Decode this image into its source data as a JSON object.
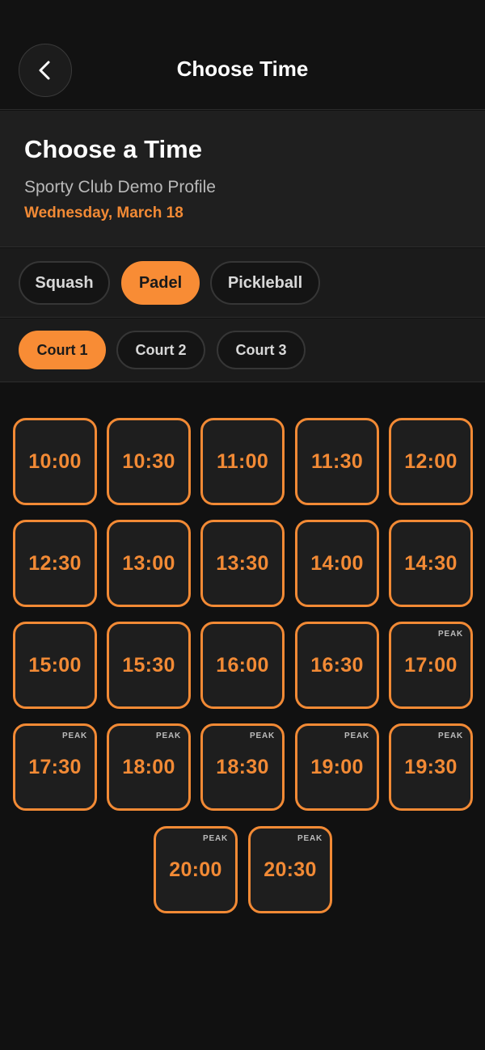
{
  "header": {
    "back_icon": "chevron-left-icon",
    "title": "Choose Time"
  },
  "info": {
    "heading": "Choose a Time",
    "club": "Sporty Club Demo Profile",
    "date": "Wednesday, March 18"
  },
  "colors": {
    "accent": "#f88c35",
    "background": "#111111",
    "panel": "#1f1f1f"
  },
  "sports": [
    {
      "label": "Squash",
      "active": false
    },
    {
      "label": "Padel",
      "active": true
    },
    {
      "label": "Pickleball",
      "active": false
    }
  ],
  "courts": [
    {
      "label": "Court 1",
      "active": true
    },
    {
      "label": "Court 2",
      "active": false
    },
    {
      "label": "Court 3",
      "active": false
    }
  ],
  "slots": [
    {
      "time": "10:00",
      "badge": ""
    },
    {
      "time": "10:30",
      "badge": ""
    },
    {
      "time": "11:00",
      "badge": ""
    },
    {
      "time": "11:30",
      "badge": ""
    },
    {
      "time": "12:00",
      "badge": ""
    },
    {
      "time": "12:30",
      "badge": ""
    },
    {
      "time": "13:00",
      "badge": ""
    },
    {
      "time": "13:30",
      "badge": ""
    },
    {
      "time": "14:00",
      "badge": ""
    },
    {
      "time": "14:30",
      "badge": ""
    },
    {
      "time": "15:00",
      "badge": ""
    },
    {
      "time": "15:30",
      "badge": ""
    },
    {
      "time": "16:00",
      "badge": ""
    },
    {
      "time": "16:30",
      "badge": ""
    },
    {
      "time": "17:00",
      "badge": "PEAK"
    },
    {
      "time": "17:30",
      "badge": "PEAK"
    },
    {
      "time": "18:00",
      "badge": "PEAK"
    },
    {
      "time": "18:30",
      "badge": "PEAK"
    },
    {
      "time": "19:00",
      "badge": "PEAK"
    },
    {
      "time": "19:30",
      "badge": "PEAK"
    },
    {
      "time": "20:00",
      "badge": "PEAK"
    },
    {
      "time": "20:30",
      "badge": "PEAK"
    }
  ]
}
